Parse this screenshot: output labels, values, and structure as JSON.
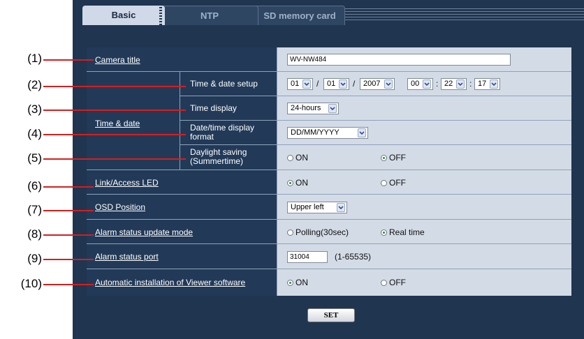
{
  "tabs": [
    {
      "label": "Basic",
      "active": true
    },
    {
      "label": "NTP",
      "active": false
    },
    {
      "label": "SD memory card",
      "active": false
    }
  ],
  "callouts": [
    "(1)",
    "(2)",
    "(3)",
    "(4)",
    "(5)",
    "(6)",
    "(7)",
    "(8)",
    "(9)",
    "(10)"
  ],
  "rows": {
    "camera_title": {
      "label": "Camera title",
      "value": "WV-NW484"
    },
    "time_date": {
      "label": "Time & date",
      "setup_label": "Time & date setup",
      "day": "01",
      "month": "01",
      "year": "2007",
      "hour": "00",
      "minute": "22",
      "second": "17",
      "date_sep": "/",
      "time_sep": ":",
      "display_label": "Time display",
      "display_value": "24-hours",
      "format_label": "Date/time display format",
      "format_value": "DD/MM/YYYY",
      "daylight_label": "Daylight saving (Summertime)",
      "daylight_on": "ON",
      "daylight_off": "OFF",
      "daylight_selected": "OFF"
    },
    "link_led": {
      "label": "Link/Access LED",
      "on": "ON",
      "off": "OFF",
      "selected": "ON"
    },
    "osd_position": {
      "label": "OSD Position",
      "value": "Upper left"
    },
    "alarm_update": {
      "label": "Alarm status update mode",
      "opt1": "Polling(30sec)",
      "opt2": "Real time",
      "selected": "Real time"
    },
    "alarm_port": {
      "label": "Alarm status port",
      "value": "31004",
      "range": "(1-65535)"
    },
    "viewer_install": {
      "label": "Automatic installation of Viewer software",
      "on": "ON",
      "off": "OFF",
      "selected": "ON"
    }
  },
  "buttons": {
    "set": "SET"
  },
  "colors": {
    "panel": "#1f3550",
    "label_cell": "#223a58",
    "value_cell": "#d3dbe6",
    "callout_line": "#d41f1f",
    "radio_selected": "#2a8a3a"
  }
}
